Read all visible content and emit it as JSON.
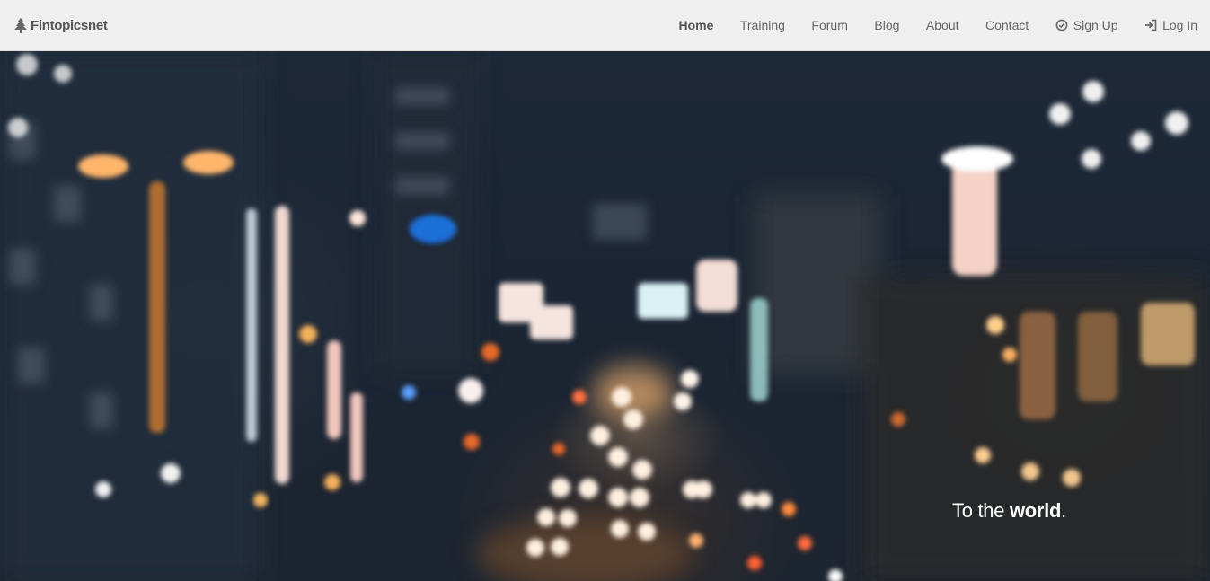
{
  "brand": {
    "name": "Fintopicsnet",
    "icon": "tree-icon"
  },
  "nav": {
    "items": [
      {
        "label": "Home",
        "active": true
      },
      {
        "label": "Training",
        "active": false
      },
      {
        "label": "Forum",
        "active": false
      },
      {
        "label": "Blog",
        "active": false
      },
      {
        "label": "About",
        "active": false
      },
      {
        "label": "Contact",
        "active": false
      },
      {
        "label": "Sign Up",
        "icon": "check-circle-icon"
      },
      {
        "label": "Log In",
        "icon": "sign-in-icon"
      }
    ]
  },
  "hero": {
    "tagline_prefix": "To the ",
    "tagline_emphasis": "world",
    "tagline_suffix": "."
  },
  "colors": {
    "navbar": "#efefef",
    "nav_text": "#666666",
    "hero_bg": "#1c2633",
    "tagline": "#ffffff"
  }
}
